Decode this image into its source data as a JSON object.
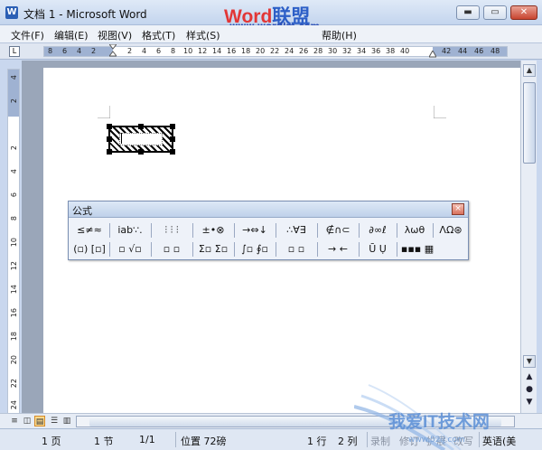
{
  "window": {
    "title": "文档 1 - Microsoft Word",
    "buttons": {
      "minimize": "▬",
      "restore": "▭",
      "close": "✕"
    }
  },
  "watermark": {
    "part1": "Word",
    "part2": "联盟",
    "url": "www.wordlm.com"
  },
  "menu": [
    "文件(F)",
    "编辑(E)",
    "视图(V)",
    "格式(T)",
    "样式(S)",
    "帮助(H)"
  ],
  "ruler": {
    "corner": "L",
    "h_ticks": [
      "8",
      "6",
      "4",
      "2",
      "2",
      "4",
      "6",
      "8",
      "10",
      "12",
      "14",
      "16",
      "18",
      "20",
      "22",
      "24",
      "26",
      "28",
      "30",
      "32",
      "34",
      "36",
      "38",
      "40",
      "42",
      "44",
      "46",
      "48"
    ],
    "v_ticks": [
      "4",
      "2",
      "2",
      "4",
      "6",
      "8",
      "10",
      "12",
      "14",
      "16",
      "18",
      "20",
      "22",
      "24"
    ]
  },
  "equation_toolbar": {
    "title": "公式",
    "close": "×",
    "row1": [
      "≤≠≈",
      "ⅰab∵.",
      "⫶ ⫶ ⫶",
      "±•⊗",
      "→⇔↓",
      "∴∀∃",
      "∉∩⊂",
      "∂∞ℓ",
      "λωθ",
      "ΛΩ⊛"
    ],
    "row2": [
      "(▫) [▫]",
      "▫ √▫",
      "▫ ▫",
      "Σ▫ Σ▫",
      "∫▫ ∮▫",
      "▫ ▫",
      "→ ←",
      "Ū Ụ",
      "▪▪▪ ▦"
    ]
  },
  "status": {
    "page": "1 页",
    "section": "1 节",
    "pages": "1/1",
    "position": "位置 72磅",
    "line": "1 行",
    "column": "2 列",
    "record": "录制",
    "revision": "修订",
    "extend": "扩展",
    "overtype": "改写",
    "language": "英语(美"
  },
  "site_logo": {
    "text": "我爱IT技术网",
    "url": "www.52ij.com"
  }
}
